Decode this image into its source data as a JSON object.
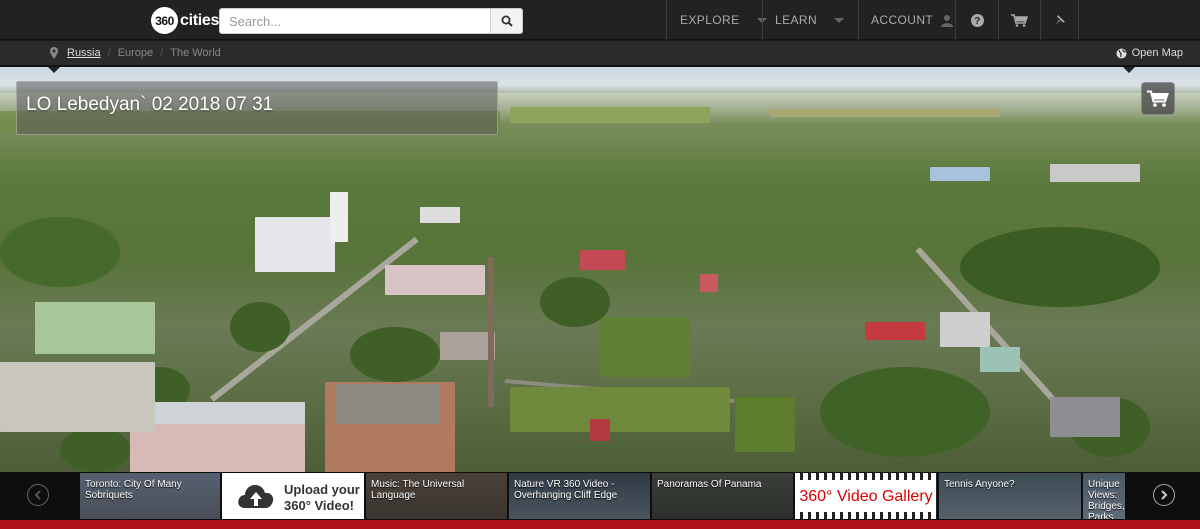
{
  "header": {
    "logo_badge": "360",
    "logo_text": "cities",
    "search_placeholder": "Search...",
    "nav": {
      "explore": "EXPLORE",
      "learn": "LEARN",
      "account": "ACCOUNT"
    },
    "icons": [
      "search-icon",
      "user-icon",
      "help-icon",
      "cart-icon",
      "pin-icon"
    ]
  },
  "breadcrumb": {
    "items": [
      "Russia",
      "Europe",
      "The World"
    ],
    "separator": "/",
    "open_map": "Open Map"
  },
  "panorama": {
    "title": "LO Lebedyan` 02 2018 07 31"
  },
  "strip": {
    "items": [
      {
        "label": "Toronto: City Of Many Sobriquets"
      },
      {
        "label": "Upload your 360° Video!"
      },
      {
        "label": "Music: The Universal Language"
      },
      {
        "label": "Nature VR 360 Video - Overhanging Cliff Edge"
      },
      {
        "label": "Panoramas Of Panama"
      },
      {
        "label": "360° Video Gallery"
      },
      {
        "label": "Tennis Anyone?"
      },
      {
        "label": "Unique Views: Bridges, Parks & Squares"
      }
    ]
  },
  "colors": {
    "topbar": "#222222",
    "accent_red": "#b0141a"
  }
}
